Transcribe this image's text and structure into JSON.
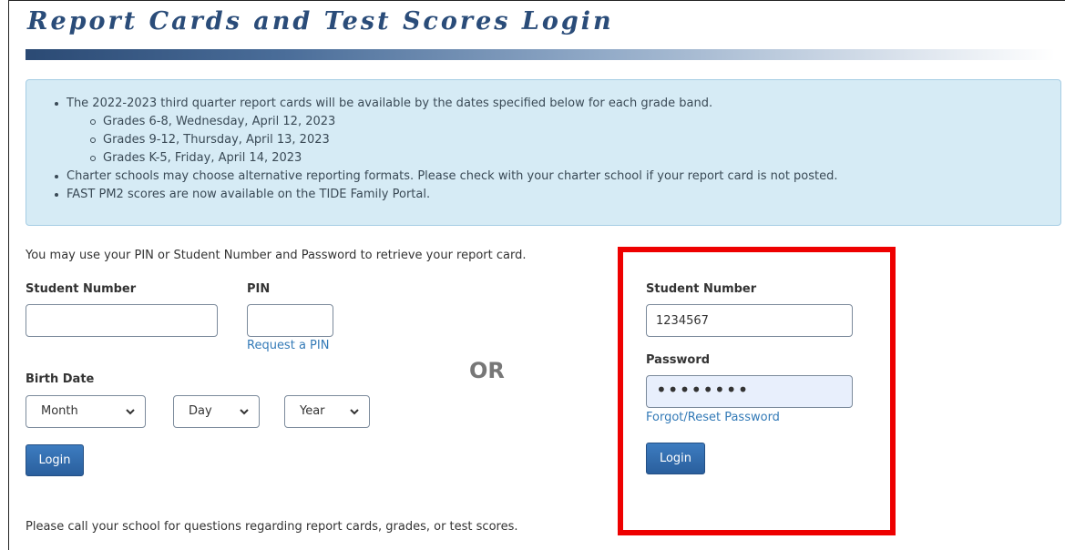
{
  "page": {
    "title": "Report Cards and Test Scores Login"
  },
  "notice": {
    "line1": "The 2022-2023 third quarter report cards will be available by the dates specified below for each grade band.",
    "grade_dates": [
      "Grades 6-8, Wednesday, April 12, 2023",
      "Grades 9-12, Thursday, April 13, 2023",
      "Grades K-5, Friday, April 14, 2023"
    ],
    "line2": "Charter schools may choose alternative reporting formats. Please check with your charter school if your report card is not posted.",
    "line3": "FAST PM2 scores are now available on the TIDE Family Portal."
  },
  "pin_login": {
    "intro": "You may use your PIN or Student Number and Password to retrieve your report card.",
    "student_number_label": "Student Number",
    "student_number_value": "",
    "pin_label": "PIN",
    "pin_value": "",
    "request_pin_link": "Request a PIN",
    "birth_date_label": "Birth Date",
    "month_value": "Month",
    "day_value": "Day",
    "year_value": "Year",
    "login_button": "Login"
  },
  "or_text": "OR",
  "password_login": {
    "student_number_label": "Student Number",
    "student_number_value": "1234567",
    "password_label": "Password",
    "password_value": "••••••••",
    "forgot_link": "Forgot/Reset Password",
    "login_button": "Login"
  },
  "footer": "Please call your school for questions regarding report cards, grades, or test scores.",
  "colors": {
    "title": "#2a4c79",
    "notice_bg": "#d6ebf5",
    "link": "#337ab7",
    "button": "#2a5f9d",
    "highlight": "#ee0000"
  },
  "icons": {
    "select_arrow": "chevron-down-icon"
  }
}
